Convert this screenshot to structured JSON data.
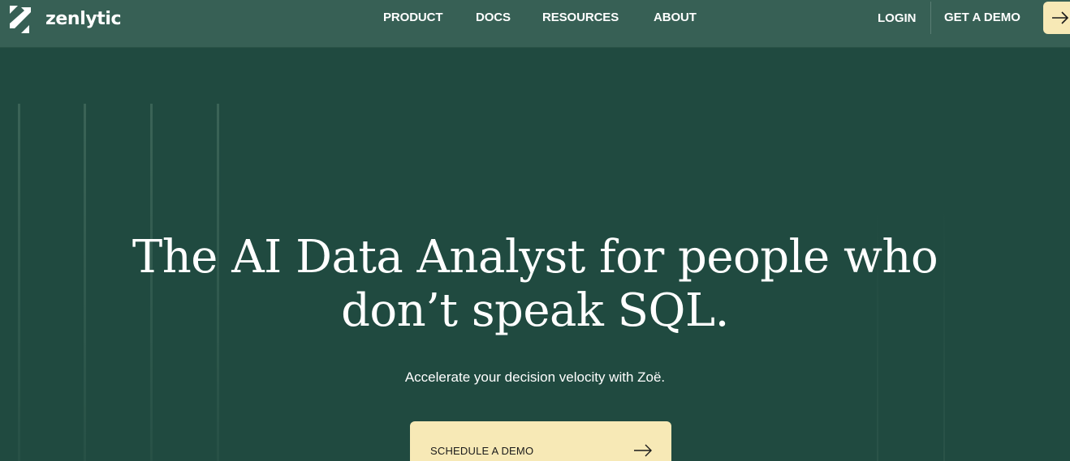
{
  "header": {
    "logo_text": "zenlytic",
    "nav": [
      {
        "label": "PRODUCT"
      },
      {
        "label": "DOCS"
      },
      {
        "label": "RESOURCES"
      },
      {
        "label": "ABOUT"
      }
    ],
    "login_label": "LOGIN",
    "demo_label": "GET A DEMO",
    "demo_arrow_icon": "arrow-right-icon"
  },
  "hero": {
    "title_line1": "The AI Data Analyst for people who",
    "title_line2": "don’t speak SQL.",
    "subtitle": "Accelerate your decision velocity with Zoë.",
    "cta_label": "SCHEDULE A DEMO",
    "cta_icon": "arrow-right-icon"
  },
  "colors": {
    "background": "#204a40",
    "header_background": "#376055",
    "accent_button": "#f7e9b6",
    "text": "#ffffff"
  }
}
